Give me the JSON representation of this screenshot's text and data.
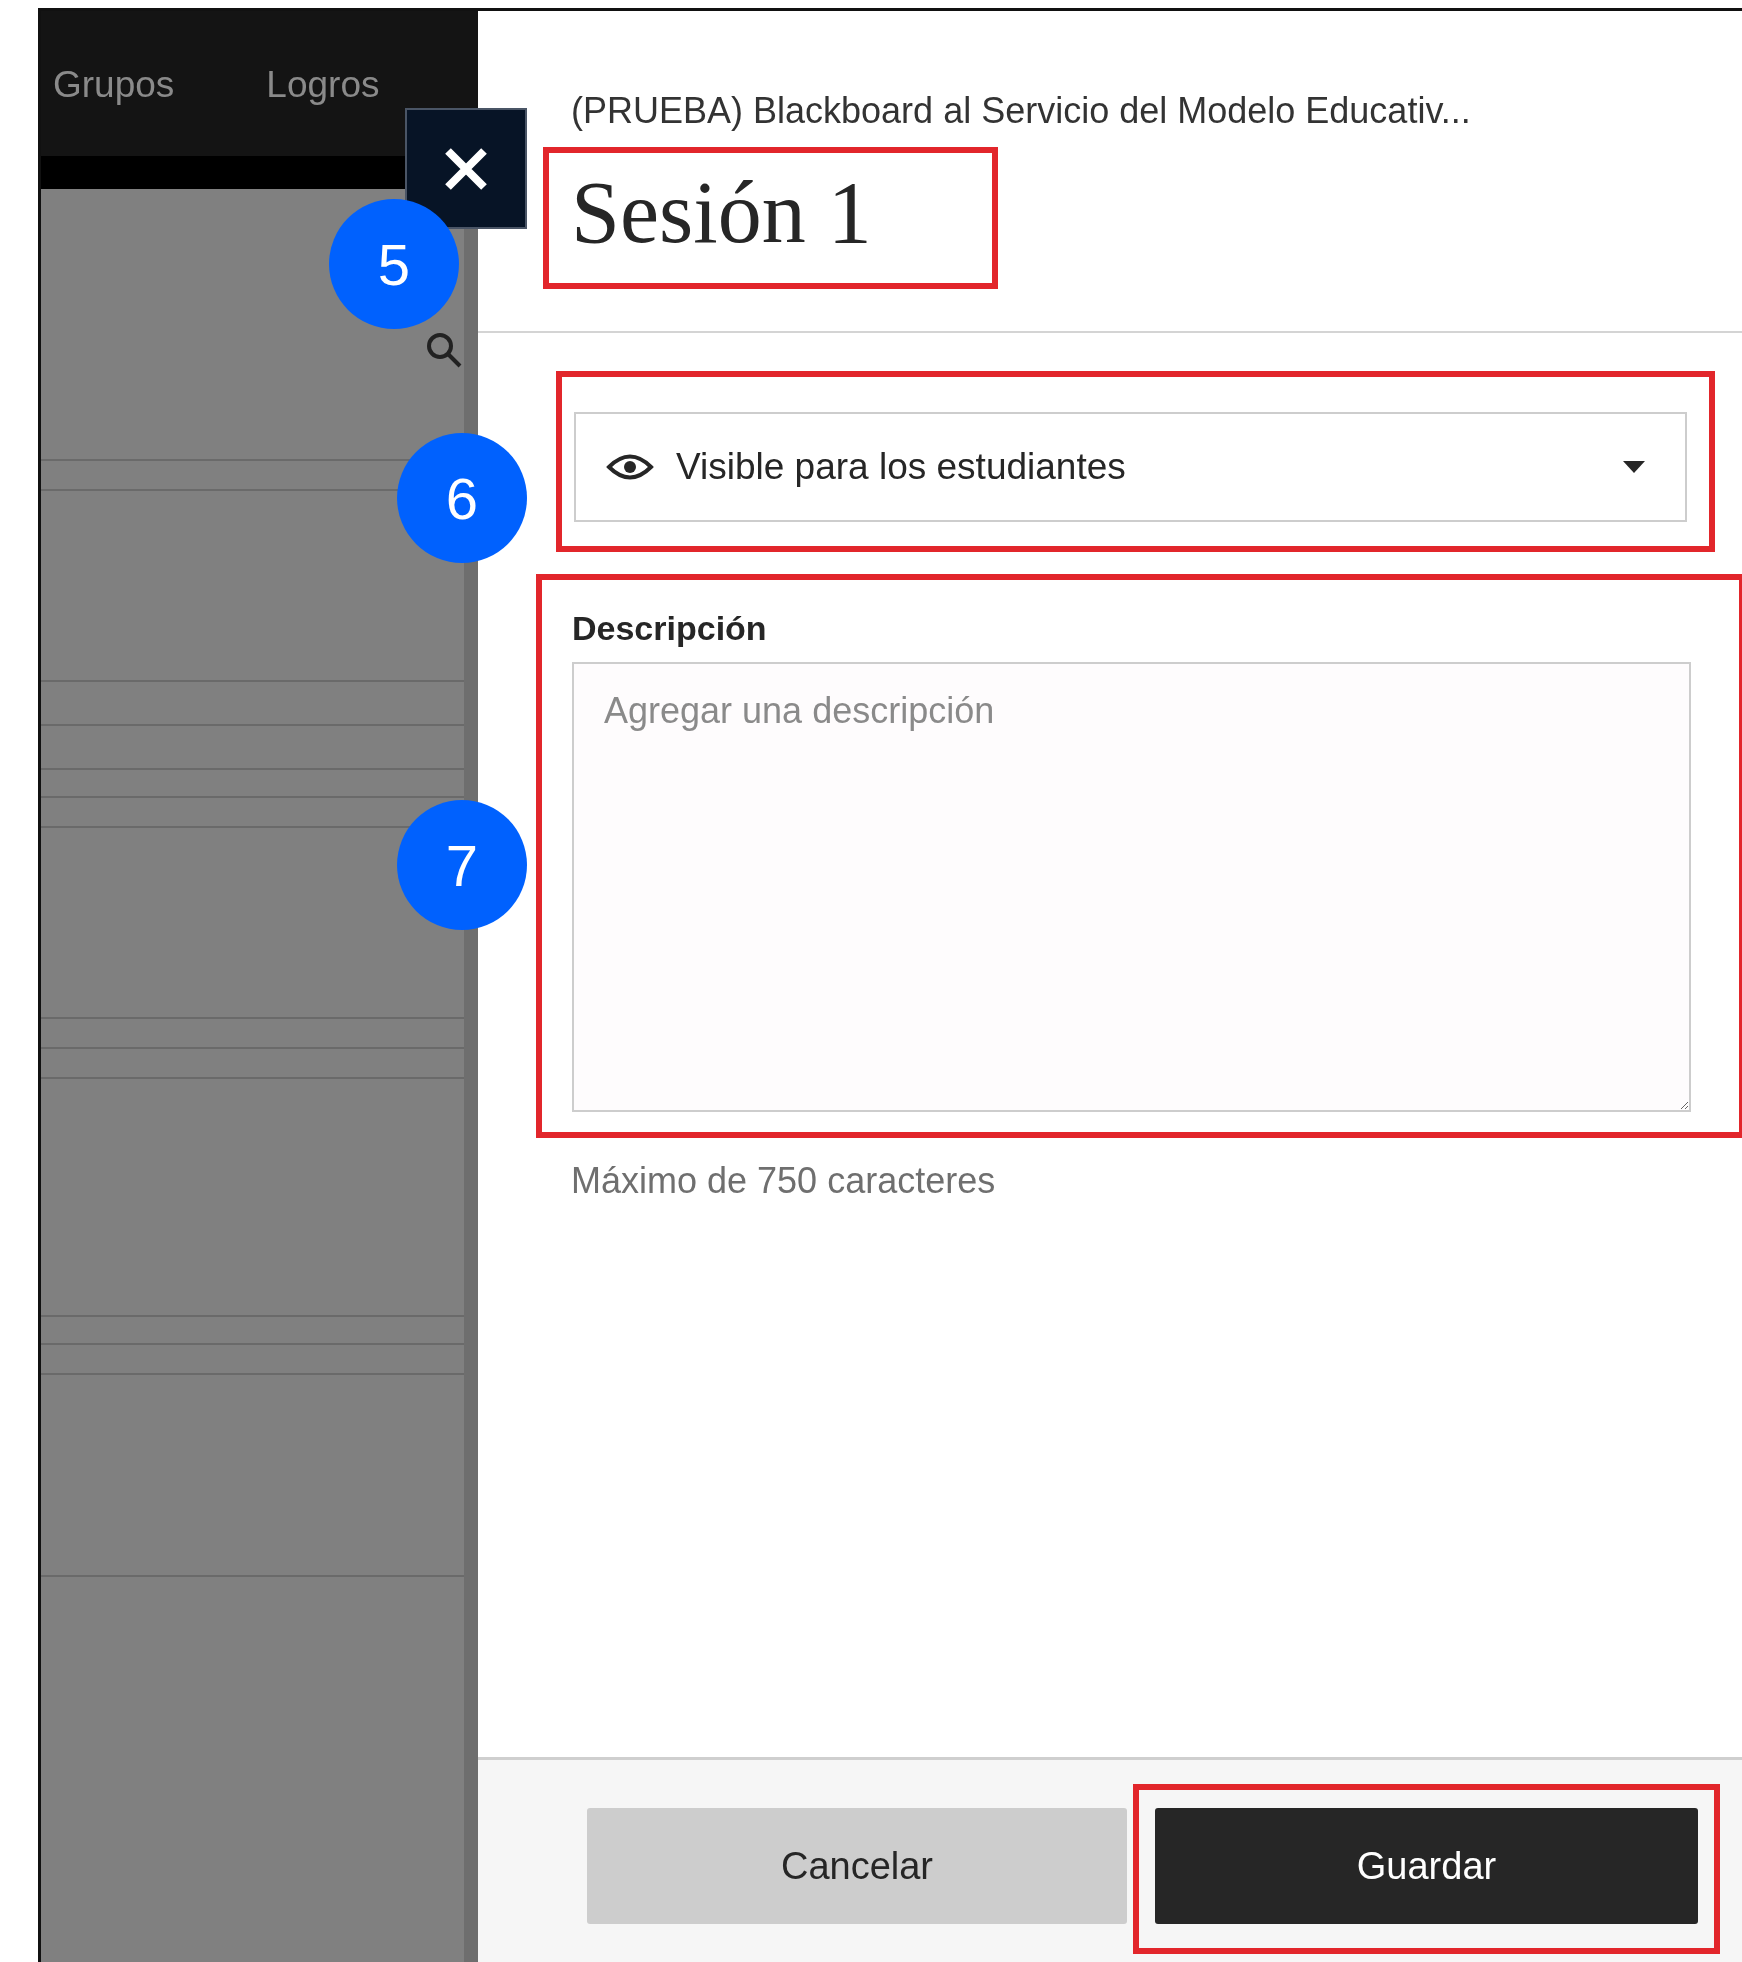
{
  "background": {
    "nav_tabs": [
      {
        "label": "Grupos"
      },
      {
        "label": "Logros"
      }
    ]
  },
  "panel": {
    "course": "(PRUEBA) Blackboard al Servicio del Modelo Educativ...",
    "title": {
      "text": "Sesión 1",
      "highlighted": true
    },
    "visibility": {
      "value": "Visible para los estudiantes",
      "highlighted": true
    },
    "description": {
      "label": "Descripción",
      "placeholder": "Agregar una descripción",
      "hint": "Máximo de 750 caracteres",
      "highlighted": true
    },
    "buttons": [
      {
        "label": "Cancelar",
        "kind": "secondary",
        "highlighted": false
      },
      {
        "label": "Guardar",
        "kind": "primary",
        "highlighted": true
      }
    ]
  },
  "callouts": [
    {
      "number": "5"
    },
    {
      "number": "6"
    },
    {
      "number": "7"
    }
  ]
}
